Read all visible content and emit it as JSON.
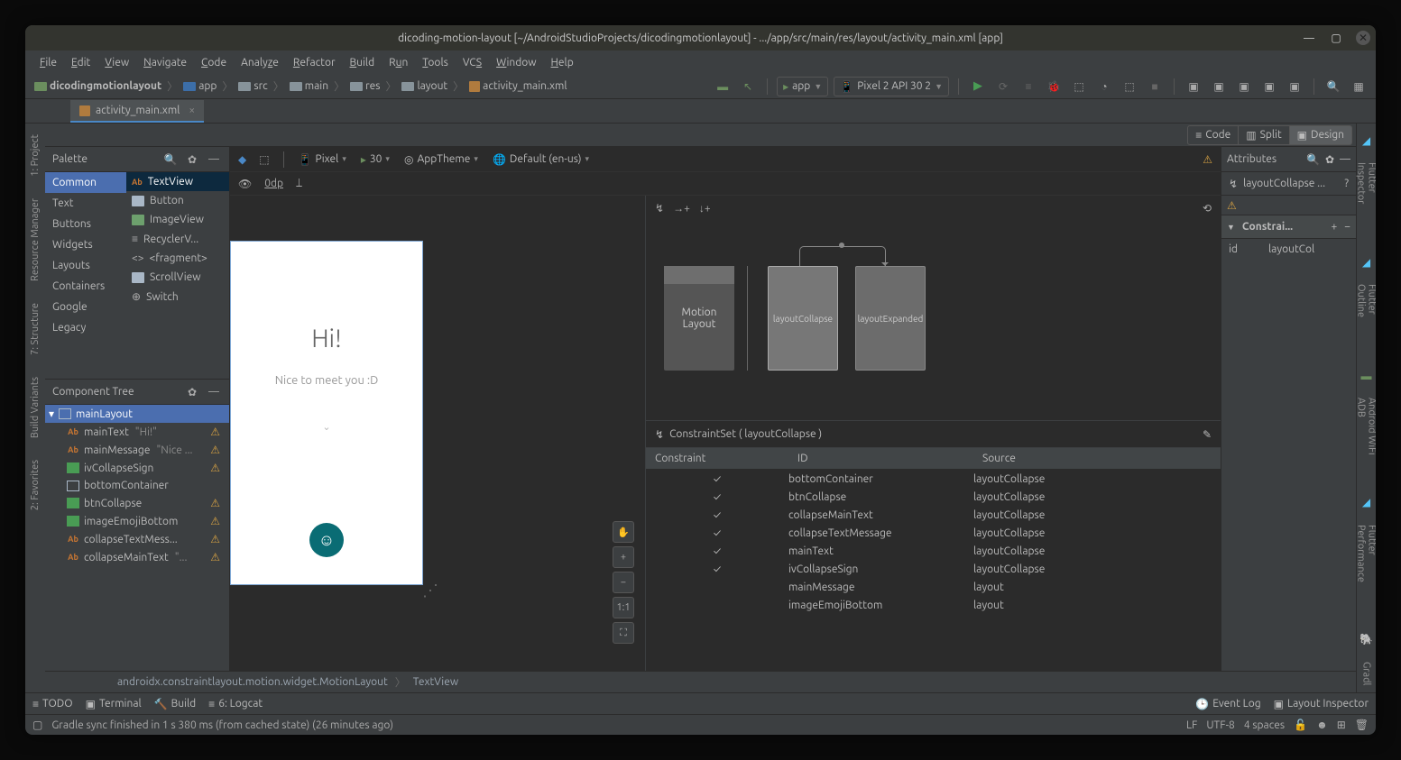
{
  "titlebar": {
    "title": "dicoding-motion-layout [~/AndroidStudioProjects/dicodingmotionlayout] - .../app/src/main/res/layout/activity_main.xml [app]"
  },
  "menus": [
    "File",
    "Edit",
    "View",
    "Navigate",
    "Code",
    "Analyze",
    "Refactor",
    "Build",
    "Run",
    "Tools",
    "VCS",
    "Window",
    "Help"
  ],
  "breadcrumbs": [
    "dicodingmotionlayout",
    "app",
    "src",
    "main",
    "res",
    "layout",
    "activity_main.xml"
  ],
  "run_config": {
    "app": "app",
    "device": "Pixel 2 API 30 2"
  },
  "tab": {
    "name": "activity_main.xml"
  },
  "view_tabs": {
    "code": "Code",
    "split": "Split",
    "design": "Design"
  },
  "palette": {
    "title": "Palette",
    "categories": [
      "Common",
      "Text",
      "Buttons",
      "Widgets",
      "Layouts",
      "Containers",
      "Google",
      "Legacy"
    ],
    "items": [
      "TextView",
      "Button",
      "ImageView",
      "RecyclerV...",
      "<fragment>",
      "ScrollView",
      "Switch"
    ]
  },
  "component_tree": {
    "title": "Component Tree",
    "root": "mainLayout",
    "children": [
      {
        "ic": "txt",
        "name": "mainText",
        "hint": "\"Hi!\"",
        "warn": true
      },
      {
        "ic": "txt",
        "name": "mainMessage",
        "hint": "\"Nice ...",
        "warn": true
      },
      {
        "ic": "img",
        "name": "ivCollapseSign",
        "hint": "",
        "warn": true
      },
      {
        "ic": "layout",
        "name": "bottomContainer",
        "hint": "",
        "warn": false
      },
      {
        "ic": "img",
        "name": "btnCollapse",
        "hint": "",
        "warn": true
      },
      {
        "ic": "img",
        "name": "imageEmojiBottom",
        "hint": "",
        "warn": true
      },
      {
        "ic": "txt",
        "name": "collapseTextMess...",
        "hint": "",
        "warn": true
      },
      {
        "ic": "txt",
        "name": "collapseMainText",
        "hint": "\"...",
        "warn": true
      }
    ]
  },
  "design_toolbar": {
    "device": "Pixel",
    "api": "30",
    "theme": "AppTheme",
    "locale": "Default (en-us)",
    "odp": "0dp"
  },
  "phone": {
    "greet": "Hi!",
    "msg": "Nice to meet you :D"
  },
  "motion": {
    "ml_label": "Motion\nLayout",
    "cs1": "layoutCollapse",
    "cs2": "layoutExpanded",
    "cset_title": "ConstraintSet ( layoutCollapse )",
    "cols": [
      "Constraint",
      "ID",
      "Source"
    ],
    "rows": [
      {
        "chk": true,
        "id": "bottomContainer",
        "src": "layoutCollapse"
      },
      {
        "chk": true,
        "id": "btnCollapse",
        "src": "layoutCollapse"
      },
      {
        "chk": true,
        "id": "collapseMainText",
        "src": "layoutCollapse"
      },
      {
        "chk": true,
        "id": "collapseTextMessage",
        "src": "layoutCollapse"
      },
      {
        "chk": true,
        "id": "mainText",
        "src": "layoutCollapse"
      },
      {
        "chk": true,
        "id": "ivCollapseSign",
        "src": "layoutCollapse"
      },
      {
        "chk": false,
        "id": "mainMessage",
        "src": "layout"
      },
      {
        "chk": false,
        "id": "imageEmojiBottom",
        "src": "layout"
      }
    ]
  },
  "attributes": {
    "title": "Attributes",
    "selected": "layoutCollapse ...",
    "section": "Constrai...",
    "row": {
      "k": "id",
      "v": "layoutCol"
    }
  },
  "path": {
    "p1": "androidx.constraintlayout.motion.widget.MotionLayout",
    "p2": "TextView"
  },
  "left_tools": [
    "1: Project",
    "Resource Manager",
    "7: Structure",
    "Build Variants",
    "2: Favorites"
  ],
  "right_tools": [
    "Flutter Inspector",
    "Flutter Outline",
    "Android WiFi ADB",
    "Flutter Performance",
    "Gradl"
  ],
  "bottom": {
    "todo": "TODO",
    "terminal": "Terminal",
    "build": "Build",
    "logcat": "6: Logcat",
    "eventlog": "Event Log",
    "inspector": "Layout Inspector"
  },
  "status": {
    "msg": "Gradle sync finished in 1 s 380 ms (from cached state) (26 minutes ago)",
    "enc": "LF",
    "charset": "UTF-8",
    "indent": "4 spaces"
  }
}
